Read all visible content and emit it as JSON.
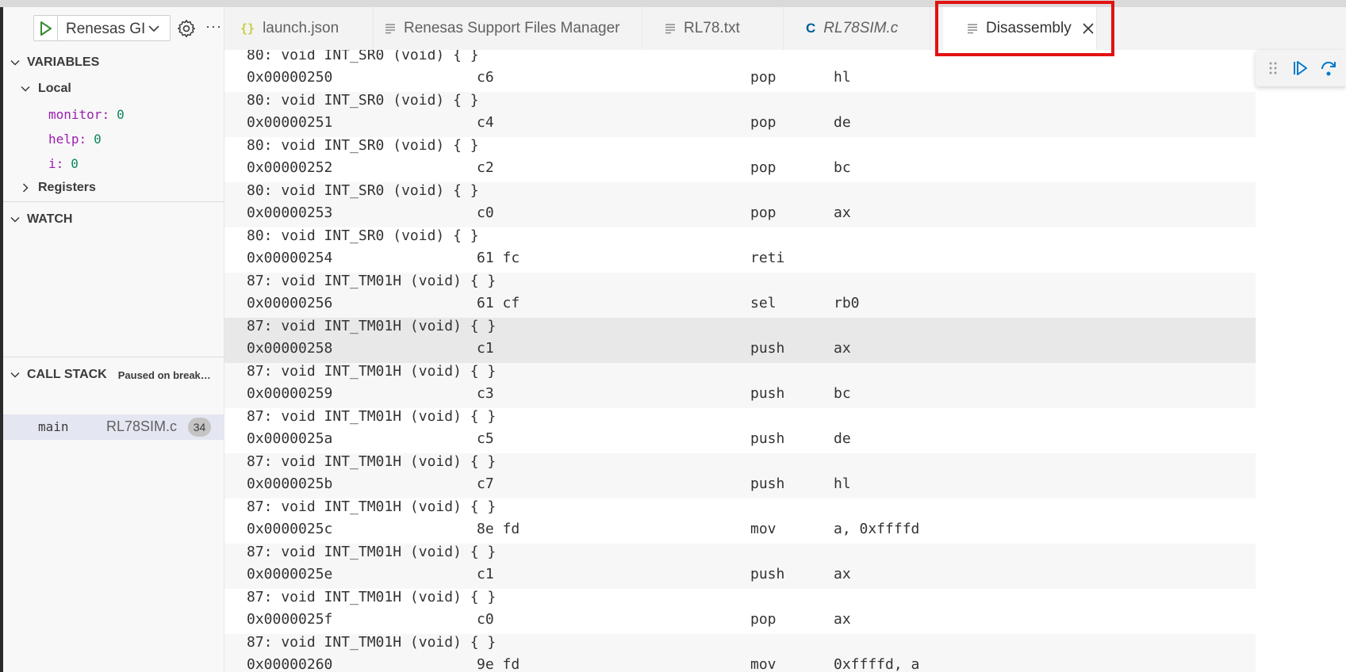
{
  "debug_toolbar": {
    "config_label": "Renesas GI"
  },
  "sidebar": {
    "variables_title": "VARIABLES",
    "local_label": "Local",
    "variables": [
      {
        "name": "monitor",
        "value": "0"
      },
      {
        "name": "help",
        "value": "0"
      },
      {
        "name": "i",
        "value": "0"
      }
    ],
    "registers_label": "Registers",
    "watch_title": "WATCH",
    "callstack_title": "CALL STACK",
    "callstack_status": "Paused on break…",
    "callstack_frame": {
      "function": "main",
      "file": "RL78SIM.c",
      "line": "34"
    }
  },
  "tabs": [
    {
      "label": "launch.json",
      "icon": "json-braces-icon",
      "active": false,
      "italic": false
    },
    {
      "label": "Renesas Support Files Manager",
      "icon": "file-lines-icon",
      "active": false,
      "italic": false
    },
    {
      "label": "RL78.txt",
      "icon": "file-lines-icon",
      "active": false,
      "italic": false
    },
    {
      "label": "RL78SIM.c",
      "icon": "c-file-icon",
      "active": false,
      "italic": true
    },
    {
      "label": "Disassembly",
      "icon": "file-lines-icon",
      "active": true,
      "italic": false
    }
  ],
  "colors": {
    "highlight": "#e11212",
    "accent": "#007acc",
    "variable_name": "#9b1eb0",
    "variable_value": "#098658",
    "json_icon": "#cbcb41",
    "c_icon": "#005f96"
  },
  "disassembly": [
    {
      "source": "80: void INT_SR0 (void) { }",
      "address": "0x00000250",
      "bytes": "c6",
      "op": "pop",
      "args": "hl"
    },
    {
      "source": "80: void INT_SR0 (void) { }",
      "address": "0x00000251",
      "bytes": "c4",
      "op": "pop",
      "args": "de"
    },
    {
      "source": "80: void INT_SR0 (void) { }",
      "address": "0x00000252",
      "bytes": "c2",
      "op": "pop",
      "args": "bc"
    },
    {
      "source": "80: void INT_SR0 (void) { }",
      "address": "0x00000253",
      "bytes": "c0",
      "op": "pop",
      "args": "ax"
    },
    {
      "source": "80: void INT_SR0 (void) { }",
      "address": "0x00000254",
      "bytes": "61 fc",
      "op": "reti",
      "args": ""
    },
    {
      "source": "87: void INT_TM01H (void) { }",
      "address": "0x00000256",
      "bytes": "61 cf",
      "op": "sel",
      "args": "rb0"
    },
    {
      "source": "87: void INT_TM01H (void) { }",
      "address": "0x00000258",
      "bytes": "c1",
      "op": "push",
      "args": "ax",
      "selected": true
    },
    {
      "source": "87: void INT_TM01H (void) { }",
      "address": "0x00000259",
      "bytes": "c3",
      "op": "push",
      "args": "bc"
    },
    {
      "source": "87: void INT_TM01H (void) { }",
      "address": "0x0000025a",
      "bytes": "c5",
      "op": "push",
      "args": "de"
    },
    {
      "source": "87: void INT_TM01H (void) { }",
      "address": "0x0000025b",
      "bytes": "c7",
      "op": "push",
      "args": "hl"
    },
    {
      "source": "87: void INT_TM01H (void) { }",
      "address": "0x0000025c",
      "bytes": "8e fd",
      "op": "mov",
      "args": "a, 0xffffd"
    },
    {
      "source": "87: void INT_TM01H (void) { }",
      "address": "0x0000025e",
      "bytes": "c1",
      "op": "push",
      "args": "ax"
    },
    {
      "source": "87: void INT_TM01H (void) { }",
      "address": "0x0000025f",
      "bytes": "c0",
      "op": "pop",
      "args": "ax"
    },
    {
      "source": "87: void INT_TM01H (void) { }",
      "address": "0x00000260",
      "bytes": "9e fd",
      "op": "mov",
      "args": "0xffffd, a"
    }
  ]
}
